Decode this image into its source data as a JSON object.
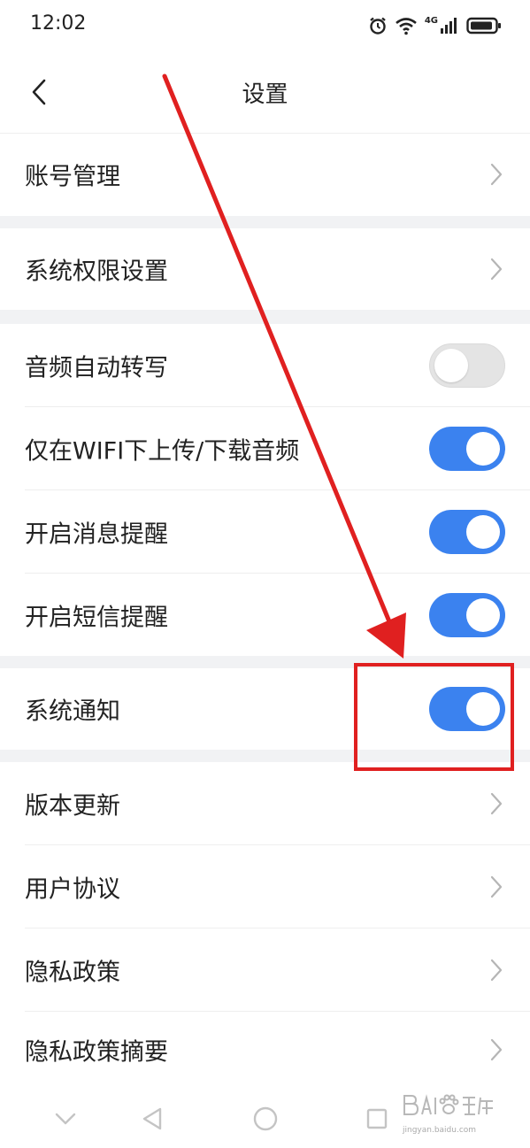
{
  "status_bar": {
    "time": "12:02",
    "network": "4G",
    "icons": [
      "alarm-icon",
      "wifi-icon",
      "signal-icon",
      "battery-icon"
    ]
  },
  "header": {
    "title": "设置",
    "back_icon": "chevron-left-icon"
  },
  "sections": [
    {
      "items": [
        {
          "id": "account",
          "label": "账号管理",
          "type": "link"
        }
      ]
    },
    {
      "items": [
        {
          "id": "permissions",
          "label": "系统权限设置",
          "type": "link"
        }
      ]
    },
    {
      "items": [
        {
          "id": "audio-transcribe",
          "label": "音频自动转写",
          "type": "toggle",
          "on": false
        },
        {
          "id": "wifi-only",
          "label": "仅在WIFI下上传/下载音频",
          "type": "toggle",
          "on": true
        },
        {
          "id": "msg-reminder",
          "label": "开启消息提醒",
          "type": "toggle",
          "on": true
        },
        {
          "id": "sms-reminder",
          "label": "开启短信提醒",
          "type": "toggle",
          "on": true
        }
      ]
    },
    {
      "items": [
        {
          "id": "system-notice",
          "label": "系统通知",
          "type": "toggle",
          "on": true
        }
      ]
    },
    {
      "items": [
        {
          "id": "version-update",
          "label": "版本更新",
          "type": "link"
        },
        {
          "id": "user-agreement",
          "label": "用户协议",
          "type": "link"
        },
        {
          "id": "privacy-policy",
          "label": "隐私政策",
          "type": "link"
        },
        {
          "id": "privacy-summary",
          "label": "隐私政策摘要",
          "type": "link"
        }
      ]
    }
  ],
  "system_nav": [
    "chevron-down-icon",
    "back-triangle-icon",
    "home-circle-icon",
    "recents-square-icon"
  ],
  "watermark": {
    "text": "jingyan.baidu.com",
    "logo": "baidu-jingyan-logo"
  },
  "colors": {
    "accent": "#3b82ef",
    "toggle_off": "#e4e4e4",
    "section_gap": "#f1f2f4",
    "annotation": "#e02020",
    "divider": "#eeeeee"
  }
}
